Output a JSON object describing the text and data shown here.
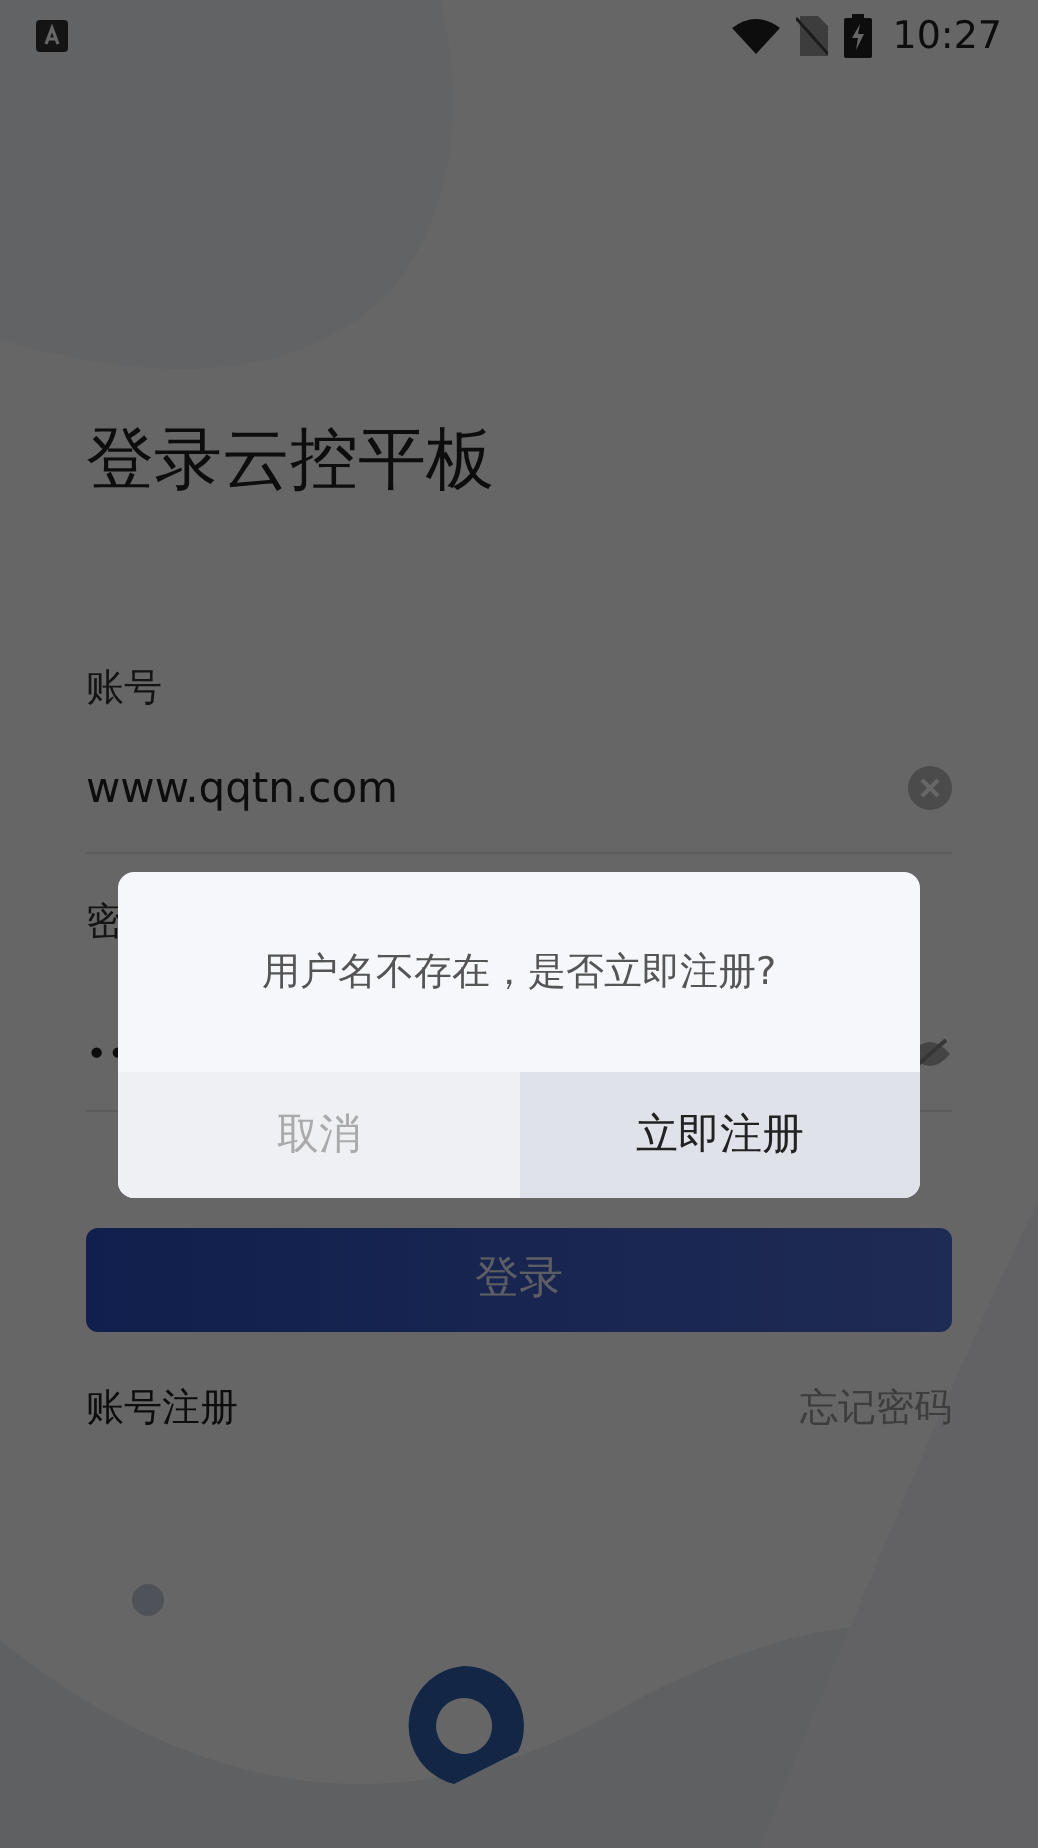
{
  "status_bar": {
    "time": "10:27"
  },
  "title": "登录云控平板",
  "account": {
    "label": "账号",
    "value": "www.qqtn.com"
  },
  "password": {
    "label": "密",
    "value": "••"
  },
  "login_button": "登录",
  "links": [
    {
      "label": "账号注册",
      "kind": "primary"
    },
    {
      "label": "忘记密码",
      "kind": "secondary"
    }
  ],
  "dialog": {
    "message": "用户名不存在，是否立即注册?",
    "buttons": [
      {
        "label": "取消",
        "kind": "cancel"
      },
      {
        "label": "立即注册",
        "kind": "confirm"
      }
    ]
  }
}
